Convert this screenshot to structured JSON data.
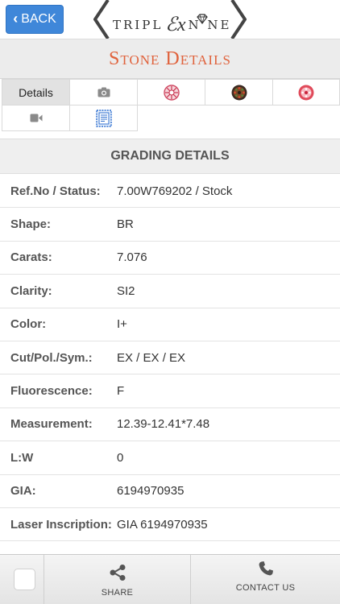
{
  "header": {
    "back_label": "BACK",
    "logo_left": "TRIPL",
    "logo_ex": "EX",
    "logo_right": "N NE"
  },
  "page_title": "Stone Details",
  "tabs": [
    {
      "label": "Details",
      "icon": "none",
      "active": true
    },
    {
      "label": "",
      "icon": "camera-icon"
    },
    {
      "label": "",
      "icon": "diamond-heart-icon"
    },
    {
      "label": "",
      "icon": "diamond-dark-icon"
    },
    {
      "label": "",
      "icon": "diamond-red-icon"
    },
    {
      "label": "",
      "icon": "video-icon"
    },
    {
      "label": "",
      "icon": "certificate-icon"
    }
  ],
  "section_title": "GRADING DETAILS",
  "details": [
    {
      "label": "Ref.No / Status:",
      "value": "7.00W769202 / Stock"
    },
    {
      "label": "Shape:",
      "value": "BR"
    },
    {
      "label": "Carats:",
      "value": "7.076"
    },
    {
      "label": "Clarity:",
      "value": "SI2"
    },
    {
      "label": "Color:",
      "value": "I+"
    },
    {
      "label": "Cut/Pol./Sym.:",
      "value": "EX / EX / EX"
    },
    {
      "label": "Fluorescence:",
      "value": "F"
    },
    {
      "label": "Measurement:",
      "value": "12.39-12.41*7.48"
    },
    {
      "label": "L:W",
      "value": "0"
    },
    {
      "label": "GIA:",
      "value": "6194970935"
    },
    {
      "label": "Laser Inscription:",
      "value": "GIA 6194970935"
    }
  ],
  "bottom_bar": {
    "share_label": "SHARE",
    "contact_label": "CONTACT US"
  },
  "colors": {
    "accent": "#3f87d9",
    "title": "#e0623c"
  }
}
